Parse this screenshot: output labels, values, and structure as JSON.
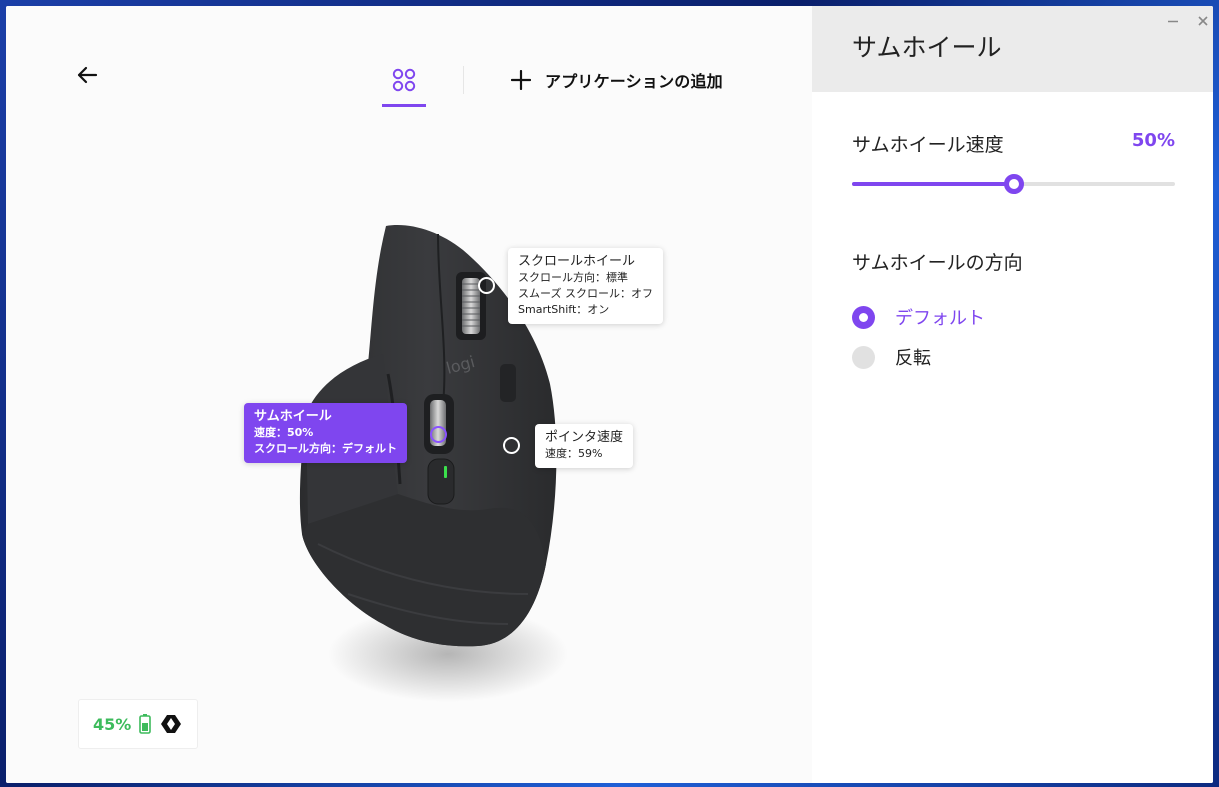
{
  "header": {
    "add_app_label": "アプリケーションの追加"
  },
  "callouts": {
    "scroll_wheel": {
      "title": "スクロールホイール",
      "line1": "スクロール方向：標準",
      "line2": "スムーズ スクロール：オフ",
      "line3": "SmartShift：オン"
    },
    "thumb_wheel": {
      "title": "サムホイール",
      "line1": "速度：50%",
      "line2": "スクロール方向：デフォルト"
    },
    "pointer_speed": {
      "title": "ポインタ速度",
      "line1": "速度：59%"
    }
  },
  "mouse": {
    "logo_text": "logi"
  },
  "battery": {
    "percent": "45%"
  },
  "panel": {
    "title": "サムホイール",
    "speed_label": "サムホイール速度",
    "speed_value": "50%",
    "speed_fraction": 0.5,
    "direction_label": "サムホイールの方向",
    "options": [
      {
        "label": "デフォルト",
        "checked": true
      },
      {
        "label": "反転",
        "checked": false
      }
    ]
  },
  "colors": {
    "accent": "#7f46ef",
    "battery": "#3dbb5c"
  },
  "icons": {
    "back": "arrow-left-icon",
    "devices": "four-circles-icon",
    "add": "plus-icon",
    "battery": "battery-icon",
    "connection": "logi-bolt-icon",
    "minimize": "minimize-icon",
    "close": "close-icon"
  }
}
